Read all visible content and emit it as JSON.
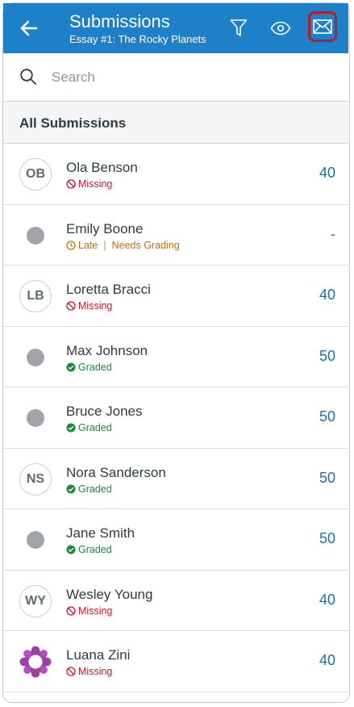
{
  "header": {
    "title": "Submissions",
    "subtitle": "Essay #1: The Rocky Planets"
  },
  "search": {
    "placeholder": "Search"
  },
  "section": {
    "title": "All Submissions"
  },
  "colors": {
    "brand": "#1d80c8",
    "missing": "#d2112c",
    "graded": "#1b8a3c",
    "late": "#c76a0a",
    "score": "#1d6fa8",
    "highlight": "#b21f2d"
  },
  "students": [
    {
      "name": "Ola Benson",
      "avatar": "OB",
      "avatar_type": "initials",
      "status": "Missing",
      "status_type": "missing",
      "score": "40"
    },
    {
      "name": "Emily Boone",
      "avatar": "",
      "avatar_type": "dot",
      "status": "Late",
      "status_type": "late",
      "extra_status": "Needs Grading",
      "score": "-"
    },
    {
      "name": "Loretta Bracci",
      "avatar": "LB",
      "avatar_type": "initials",
      "status": "Missing",
      "status_type": "missing",
      "score": "40"
    },
    {
      "name": "Max Johnson",
      "avatar": "",
      "avatar_type": "dot",
      "status": "Graded",
      "status_type": "graded",
      "score": "50"
    },
    {
      "name": "Bruce Jones",
      "avatar": "",
      "avatar_type": "dot",
      "status": "Graded",
      "status_type": "graded",
      "score": "50"
    },
    {
      "name": "Nora Sanderson",
      "avatar": "NS",
      "avatar_type": "initials",
      "status": "Graded",
      "status_type": "graded",
      "score": "50"
    },
    {
      "name": "Jane Smith",
      "avatar": "",
      "avatar_type": "dot",
      "status": "Graded",
      "status_type": "graded",
      "score": "50"
    },
    {
      "name": "Wesley Young",
      "avatar": "WY",
      "avatar_type": "initials",
      "status": "Missing",
      "status_type": "missing",
      "score": "40"
    },
    {
      "name": "Luana Zini",
      "avatar": "",
      "avatar_type": "image",
      "status": "Missing",
      "status_type": "missing",
      "score": "40"
    }
  ]
}
